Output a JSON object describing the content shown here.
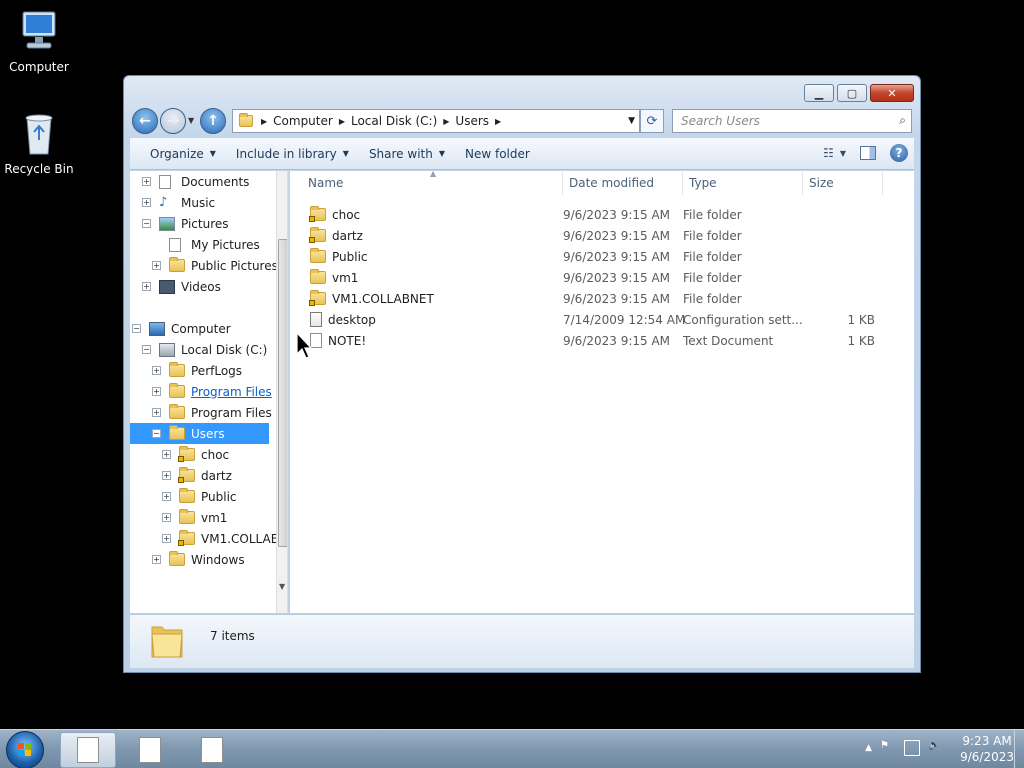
{
  "desktop": {
    "icons": [
      {
        "label": "Computer",
        "icon": "computer-icon"
      },
      {
        "label": "Recycle Bin",
        "icon": "recycle-bin-icon"
      }
    ]
  },
  "window": {
    "address": {
      "crumbs": [
        "Computer",
        "Local Disk (C:)",
        "Users"
      ]
    },
    "search_placeholder": "Search Users",
    "toolbar": {
      "organize": "Organize",
      "include_in_library": "Include in library",
      "share_with": "Share with",
      "new_folder": "New folder"
    },
    "tree": [
      {
        "label": "Documents",
        "icon": "documents-library-icon"
      },
      {
        "label": "Music",
        "icon": "music-library-icon"
      },
      {
        "label": "Pictures",
        "icon": "pictures-library-icon"
      },
      {
        "label": "My Pictures",
        "icon": "folder-icon"
      },
      {
        "label": "Public Pictures",
        "icon": "folder-icon"
      },
      {
        "label": "Videos",
        "icon": "videos-library-icon"
      },
      {
        "label": "Computer",
        "icon": "computer-icon"
      },
      {
        "label": "Local Disk (C:)",
        "icon": "drive-icon"
      },
      {
        "label": "PerfLogs",
        "icon": "folder-icon"
      },
      {
        "label": "Program Files",
        "icon": "folder-icon"
      },
      {
        "label": "Program Files (",
        "icon": "folder-icon"
      },
      {
        "label": "Users",
        "icon": "folder-icon"
      },
      {
        "label": "choc",
        "icon": "locked-folder-icon"
      },
      {
        "label": "dartz",
        "icon": "locked-folder-icon"
      },
      {
        "label": "Public",
        "icon": "folder-icon"
      },
      {
        "label": "vm1",
        "icon": "folder-icon"
      },
      {
        "label": "VM1.COLLAE",
        "icon": "locked-folder-icon"
      },
      {
        "label": "Windows",
        "icon": "folder-icon"
      }
    ],
    "columns": {
      "name": "Name",
      "date": "Date modified",
      "type": "Type",
      "size": "Size"
    },
    "files": [
      {
        "name": "choc",
        "date": "9/6/2023 9:15 AM",
        "type": "File folder",
        "size": "",
        "icon": "locked-folder-icon"
      },
      {
        "name": "dartz",
        "date": "9/6/2023 9:15 AM",
        "type": "File folder",
        "size": "",
        "icon": "locked-folder-icon"
      },
      {
        "name": "Public",
        "date": "9/6/2023 9:15 AM",
        "type": "File folder",
        "size": "",
        "icon": "folder-icon"
      },
      {
        "name": "vm1",
        "date": "9/6/2023 9:15 AM",
        "type": "File folder",
        "size": "",
        "icon": "folder-icon"
      },
      {
        "name": "VM1.COLLABNET",
        "date": "9/6/2023 9:15 AM",
        "type": "File folder",
        "size": "",
        "icon": "locked-folder-icon"
      },
      {
        "name": "desktop",
        "date": "7/14/2009 12:54 AM",
        "type": "Configuration sett...",
        "size": "1 KB",
        "icon": "config-file-icon"
      },
      {
        "name": "NOTE!",
        "date": "9/6/2023 9:15 AM",
        "type": "Text Document",
        "size": "1 KB",
        "icon": "text-file-icon"
      }
    ],
    "details": {
      "count": "7 items"
    }
  },
  "taskbar": {
    "clock_time": "9:23 AM",
    "clock_date": "9/6/2023"
  }
}
